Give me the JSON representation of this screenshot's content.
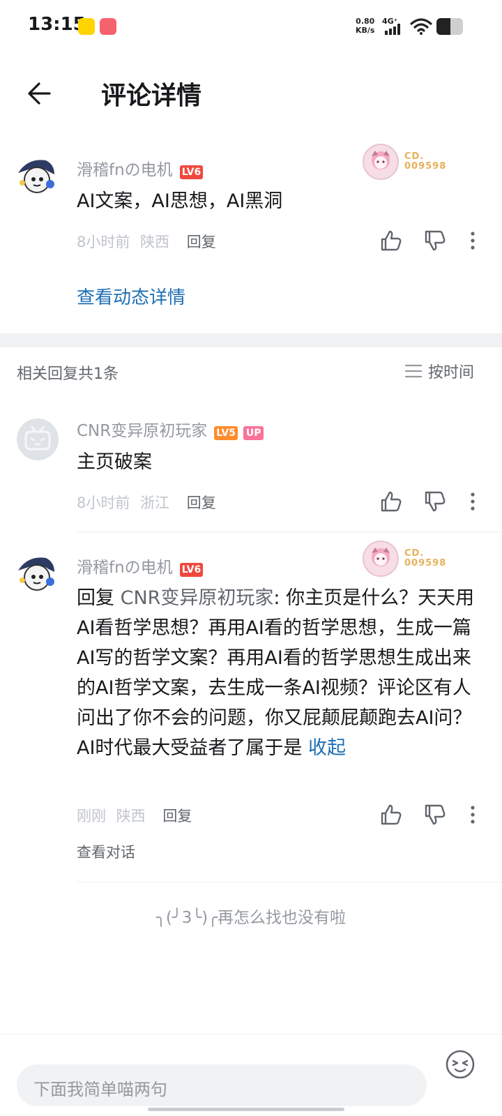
{
  "status_bar": {
    "time": "13:15",
    "speed_value": "0.80",
    "speed_unit": "KB/s",
    "network": "4G⁺"
  },
  "header": {
    "title": "评论详情"
  },
  "main_comment": {
    "username": "滑稽fnの电机",
    "level": "LV6",
    "text": "AI文案，AI思想，AI黑洞",
    "time": "8小时前",
    "location": "陕西",
    "reply_label": "回复",
    "fan_badge_line1": "CD.",
    "fan_badge_line2": "009598",
    "view_dynamic": "查看动态详情"
  },
  "replies_header": {
    "count_text": "相关回复共1条",
    "sort_label": "按时间"
  },
  "replies": [
    {
      "username": "CNR变异原初玩家",
      "level": "LV5",
      "up_badge": "UP",
      "text": "主页破案",
      "time": "8小时前",
      "location": "浙江",
      "reply_label": "回复"
    },
    {
      "username": "滑稽fnの电机",
      "level": "LV6",
      "reply_prefix": "回复 ",
      "mention": "CNR变异原初玩家",
      "text": ": 你主页是什么？天天用AI看哲学思想？再用AI看的哲学思想，生成一篇AI写的哲学文案？再用AI看的哲学思想生成出来的AI哲学文案，去生成一条AI视频？评论区有人问出了你不会的问题，你又屁颠屁颠跑去AI问？AI时代最大受益者了属于是",
      "collapse_label": "收起",
      "time": "刚刚",
      "location": "陕西",
      "reply_label": "回复",
      "view_dialog": "查看对话",
      "fan_badge_line1": "CD.",
      "fan_badge_line2": "009598"
    }
  ],
  "end_text": "╮(╯3╰)╭再怎么找也没有啦",
  "bottom_bar": {
    "input_placeholder": "下面我简单喵两句"
  },
  "colors": {
    "lv6": "#f0483e",
    "lv5": "#ff8c2c",
    "up": "#fb7299",
    "link": "#1e6fb4",
    "muted": "#9499a0"
  },
  "icons": [
    "back-arrow-icon",
    "thumb-up-icon",
    "thumb-down-icon",
    "more-icon",
    "sort-icon",
    "emoji-icon",
    "wifi-icon",
    "signal-icon",
    "battery-icon"
  ]
}
